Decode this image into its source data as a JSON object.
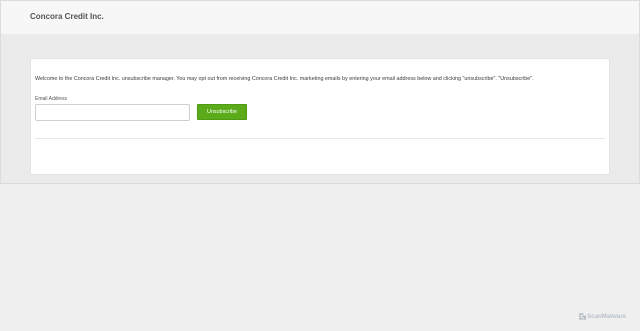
{
  "header": {
    "brand": "Concora Credit Inc."
  },
  "form": {
    "intro_text": "Welcome to the Concora Credit Inc. unsubscribe manager. You may opt out from receiving Concora Credit Inc. marketing emails by entering your email address below and clicking \"unsubscribe\". \"Unsubscribe\".",
    "email_label": "Email Address",
    "email_value": "",
    "email_placeholder": "",
    "submit_label": "Unsubscribe"
  },
  "watermark": {
    "text": "ScanMalware",
    "icon": "scanmalware-logo-icon"
  },
  "colors": {
    "button": "#5cab1b",
    "header_bg": "#f7f7f7",
    "page_bg": "#efefef"
  }
}
